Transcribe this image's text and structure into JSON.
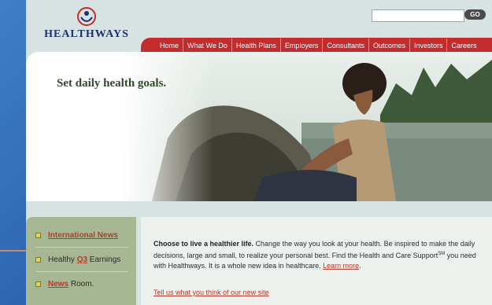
{
  "brand": {
    "name": "HEALTHWAYS"
  },
  "search": {
    "placeholder": "",
    "go_label": "GO"
  },
  "nav": {
    "items": [
      "Home",
      "What We Do",
      "Health Plans",
      "Employers",
      "Consultants",
      "Outcomes",
      "Investors",
      "Careers"
    ]
  },
  "hero": {
    "tagline": "Set daily health goals."
  },
  "sidebar": {
    "items": [
      {
        "link": "International News",
        "text": ""
      },
      {
        "prefix": "Healthy ",
        "link": "Q3",
        "text": " Earnings"
      },
      {
        "link": "News",
        "text": " Room."
      }
    ]
  },
  "intro": {
    "lead": "Choose to live a healthier life.",
    "body1": " Change the way you look at your health. Be inspired to make the daily decisions, large and small, to realize your personal best. Find the Health and Care Support",
    "sm": "SM",
    "body2": " you need with Healthways. It is a whole new idea in healthcare. ",
    "learn_more": "Learn more",
    "end": ".",
    "feedback": "Tell us what you think of our new site"
  },
  "colors": {
    "nav_red": "#c32c2c",
    "page_bg": "#d6e3e2",
    "panel_green": "#a8b793",
    "link_red": "#b53a2b",
    "logo_navy": "#1f2f6e"
  }
}
